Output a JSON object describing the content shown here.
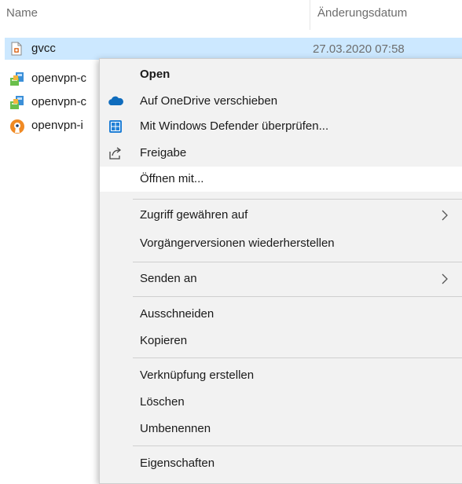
{
  "list": {
    "header": {
      "name": "Name",
      "date": "Änderungsdatum"
    },
    "rows": [
      {
        "name": "gvcc",
        "date": "27.03.2020 07:58",
        "icon": "text-file-icon",
        "selected": true
      },
      {
        "name": "openvpn-c",
        "date": "",
        "icon": "installer-package-icon"
      },
      {
        "name": "openvpn-c",
        "date": "",
        "icon": "installer-package-icon"
      },
      {
        "name": "openvpn-i",
        "date": "",
        "icon": "openvpn-logo-icon"
      }
    ]
  },
  "menu": {
    "items": [
      {
        "id": "open",
        "label": "Open",
        "bold": true
      },
      {
        "id": "onedrive",
        "label": "Auf OneDrive verschieben",
        "icon": "onedrive-cloud-icon"
      },
      {
        "id": "defender",
        "label": "Mit Windows Defender überprüfen...",
        "icon": "windows-defender-icon"
      },
      {
        "id": "share",
        "label": "Freigabe",
        "icon": "share-icon"
      },
      {
        "id": "openwith",
        "label": "Öffnen mit...",
        "hover": true
      },
      {
        "id": "grant",
        "label": "Zugriff gewähren auf",
        "submenu": true
      },
      {
        "id": "restore",
        "label": "Vorgängerversionen wiederherstellen"
      },
      {
        "id": "sendto",
        "label": "Senden an",
        "submenu": true
      },
      {
        "id": "cut",
        "label": "Ausschneiden"
      },
      {
        "id": "copy",
        "label": "Kopieren"
      },
      {
        "id": "shortcut",
        "label": "Verknüpfung erstellen"
      },
      {
        "id": "delete",
        "label": "Löschen"
      },
      {
        "id": "rename",
        "label": "Umbenennen"
      },
      {
        "id": "properties",
        "label": "Eigenschaften"
      }
    ]
  },
  "colors": {
    "selection": "#cce8ff",
    "menu_bg": "#f2f2f2",
    "menu_hover": "#ffffff",
    "onedrive_blue": "#0f6cbd",
    "defender_blue": "#1f7fd6"
  }
}
